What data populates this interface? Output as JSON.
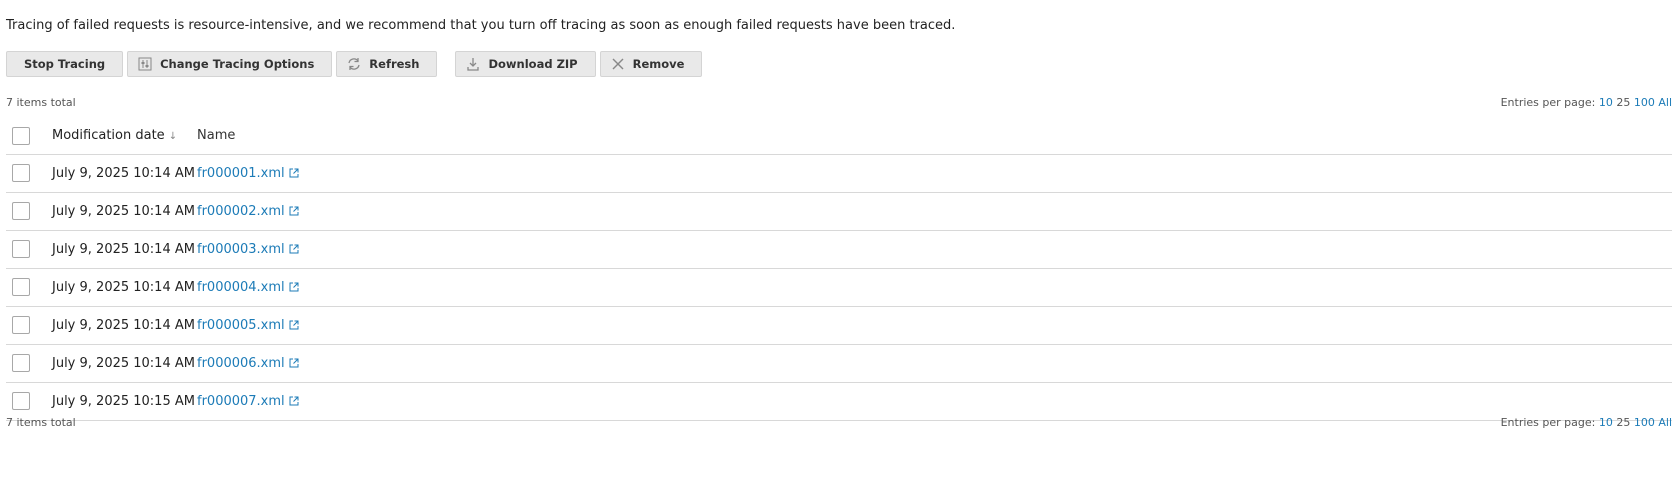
{
  "notice": "Tracing of failed requests is resource-intensive, and we recommend that you turn off tracing as soon as enough failed requests have been traced.",
  "toolbar": {
    "stop_tracing": "Stop Tracing",
    "change_options": "Change Tracing Options",
    "refresh": "Refresh",
    "download_zip": "Download ZIP",
    "remove": "Remove"
  },
  "summary_top": "7 items total",
  "summary_bottom": "7 items total",
  "entries_per_page": {
    "label": "Entries per page:",
    "options": [
      "10",
      "25",
      "100",
      "All"
    ],
    "current": "25"
  },
  "table": {
    "col_date": "Modification date",
    "sort_indicator": "↓",
    "col_name": "Name",
    "rows": [
      {
        "date": "July 9, 2025 10:14 AM",
        "name": "fr000001.xml"
      },
      {
        "date": "July 9, 2025 10:14 AM",
        "name": "fr000002.xml"
      },
      {
        "date": "July 9, 2025 10:14 AM",
        "name": "fr000003.xml"
      },
      {
        "date": "July 9, 2025 10:14 AM",
        "name": "fr000004.xml"
      },
      {
        "date": "July 9, 2025 10:14 AM",
        "name": "fr000005.xml"
      },
      {
        "date": "July 9, 2025 10:14 AM",
        "name": "fr000006.xml"
      },
      {
        "date": "July 9, 2025 10:15 AM",
        "name": "fr000007.xml"
      }
    ]
  },
  "colors": {
    "link": "#1c7bb7",
    "button_bg": "#e9e9e9",
    "divider": "#d8d8d8"
  }
}
